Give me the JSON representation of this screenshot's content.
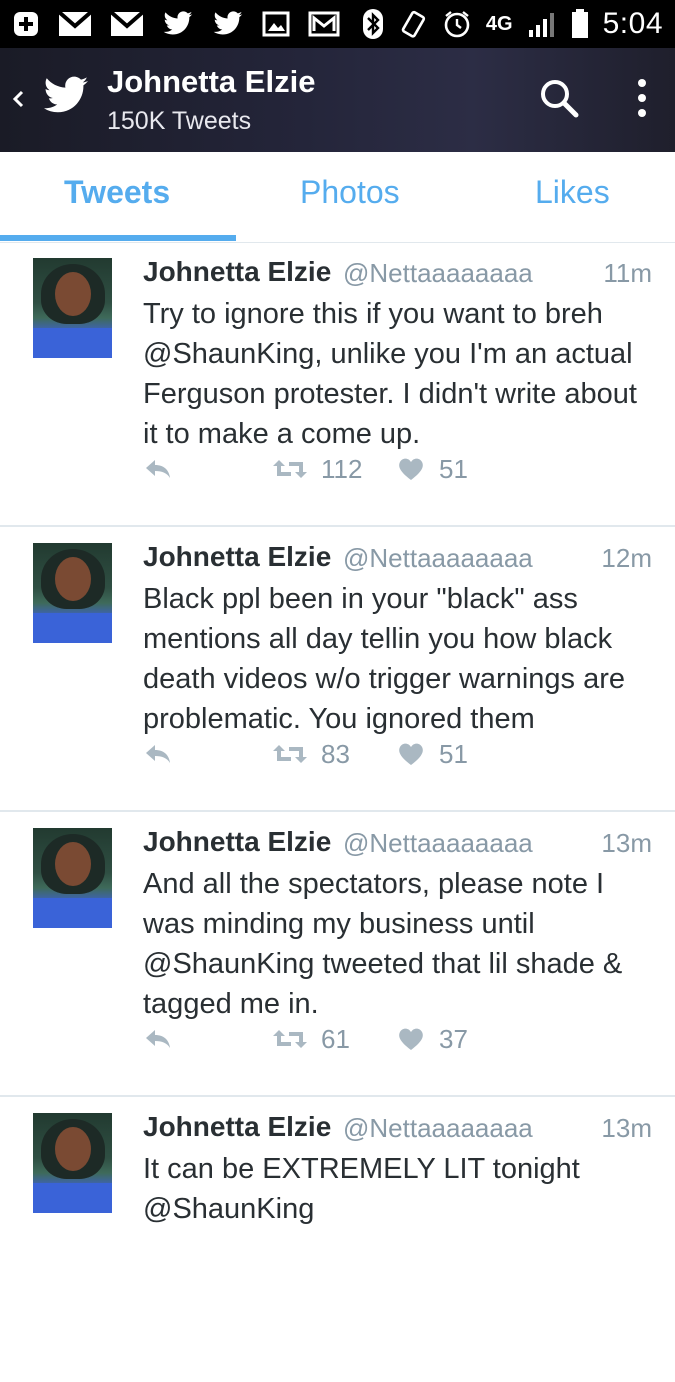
{
  "status_bar": {
    "time": "5:04",
    "network": "4G",
    "icons": [
      "plus-square-icon",
      "gmail-icon",
      "gmail-icon",
      "twitter-icon",
      "twitter-icon",
      "image-icon",
      "gmail-icon",
      "bluetooth-icon",
      "vibrate-icon",
      "alarm-icon",
      "lte-icon",
      "signal-icon",
      "battery-icon"
    ]
  },
  "header": {
    "title": "Johnetta Elzie",
    "subtitle": "150K Tweets",
    "back_icon": "chevron-left-icon",
    "logo_icon": "twitter-bird-icon",
    "search_icon": "search-icon",
    "more_icon": "more-vertical-icon"
  },
  "tabs": [
    {
      "label": "Tweets",
      "active": true
    },
    {
      "label": "Photos",
      "active": false
    },
    {
      "label": "Likes",
      "active": false
    }
  ],
  "colors": {
    "accent": "#55acee",
    "muted": "#8899a6",
    "text": "#292f33"
  },
  "tweets": [
    {
      "name": "Johnetta Elzie",
      "handle": "@Nettaaaaaaaa",
      "time": "11m",
      "text": "Try to ignore this if you want to breh @ShaunKing, unlike you I'm an actual Ferguson protester. I didn't write about it to make a come up.",
      "retweets": "112",
      "likes": "51"
    },
    {
      "name": "Johnetta Elzie",
      "handle": "@Nettaaaaaaaa",
      "time": "12m",
      "text": "Black ppl been in your \"black\" ass mentions all day tellin you how black death videos w/o trigger warnings are problematic. You ignored them",
      "retweets": "83",
      "likes": "51"
    },
    {
      "name": "Johnetta Elzie",
      "handle": "@Nettaaaaaaaa",
      "time": "13m",
      "text": "And all the spectators, please note I was minding my business until @ShaunKing tweeted that lil shade & tagged me in.",
      "retweets": "61",
      "likes": "37"
    },
    {
      "name": "Johnetta Elzie",
      "handle": "@Nettaaaaaaaa",
      "time": "13m",
      "text": "It can be EXTREMELY LIT tonight @ShaunKing",
      "retweets": "",
      "likes": ""
    }
  ]
}
